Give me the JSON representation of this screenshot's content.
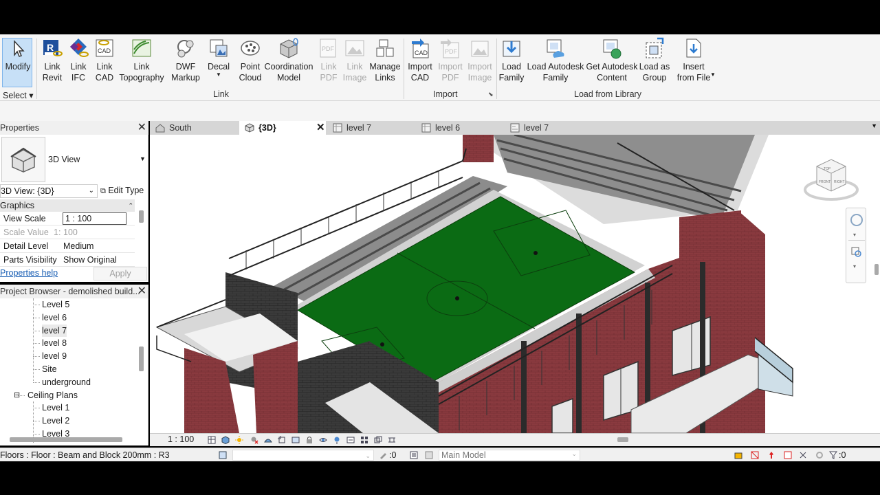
{
  "ribbon": {
    "buttons": [
      {
        "label": "Modify",
        "icon": "cursor-arrow-icon"
      },
      {
        "label": "Link\nRevit",
        "icon": "link-revit-icon"
      },
      {
        "label": "Link\nIFC",
        "icon": "link-ifc-icon"
      },
      {
        "label": "Link\nCAD",
        "icon": "link-cad-icon"
      },
      {
        "label": "Link\nTopography",
        "icon": "link-topography-icon"
      },
      {
        "label": "DWF\nMarkup",
        "icon": "dwf-markup-icon"
      },
      {
        "label": "Decal",
        "icon": "decal-icon"
      },
      {
        "label": "Point\nCloud",
        "icon": "point-cloud-icon"
      },
      {
        "label": "Coordination\nModel",
        "icon": "coordination-model-icon"
      },
      {
        "label": "Link\nPDF",
        "icon": "link-pdf-icon",
        "disabled": true
      },
      {
        "label": "Link\nImage",
        "icon": "link-image-icon",
        "disabled": true
      },
      {
        "label": "Manage\nLinks",
        "icon": "manage-links-icon"
      },
      {
        "label": "Import\nCAD",
        "icon": "import-cad-icon"
      },
      {
        "label": "Import\nPDF",
        "icon": "import-pdf-icon",
        "disabled": true
      },
      {
        "label": "Import\nImage",
        "icon": "import-image-icon",
        "disabled": true
      },
      {
        "label": "Load\nFamily",
        "icon": "load-family-icon"
      },
      {
        "label": "Load Autodesk\nFamily",
        "icon": "load-autodesk-family-icon"
      },
      {
        "label": "Get Autodesk\nContent",
        "icon": "get-autodesk-content-icon"
      },
      {
        "label": "Load as\nGroup",
        "icon": "load-as-group-icon"
      },
      {
        "label": "Insert\nfrom File",
        "icon": "insert-from-file-icon"
      }
    ],
    "panels": {
      "select": "Select",
      "link": "Link",
      "import": "Import",
      "load_from_library": "Load from Library"
    }
  },
  "tabs": [
    {
      "label": "South",
      "icon": "elevation-view-icon"
    },
    {
      "label": "{3D}",
      "icon": "3d-view-icon",
      "active": true
    },
    {
      "label": "level 7",
      "icon": "plan-view-icon"
    },
    {
      "label": "level 6",
      "icon": "plan-view-icon"
    },
    {
      "label": "level 7",
      "icon": "ceiling-plan-icon"
    }
  ],
  "properties": {
    "title": "Properties",
    "type_name": "3D View",
    "view_selector": "3D View: {3D}",
    "edit_type": "Edit Type",
    "group": "Graphics",
    "rows": [
      {
        "key": "View Scale",
        "value": "1 : 100"
      },
      {
        "key": "Scale Value",
        "prefix": "1:",
        "value": "100",
        "dim": true
      },
      {
        "key": "Detail Level",
        "value": "Medium"
      },
      {
        "key": "Parts Visibility",
        "value": "Show Original"
      }
    ],
    "help": "Properties help",
    "apply": "Apply"
  },
  "browser": {
    "title": "Project Browser - demolished build...",
    "items": [
      {
        "label": "Level 5",
        "level": 2
      },
      {
        "label": "level 6",
        "level": 2
      },
      {
        "label": "level 7",
        "level": 2,
        "selected": true
      },
      {
        "label": "level 8",
        "level": 2
      },
      {
        "label": "level 9",
        "level": 2
      },
      {
        "label": "Site",
        "level": 2
      },
      {
        "label": "underground",
        "level": 2
      },
      {
        "label": "Ceiling Plans",
        "level": 1,
        "expander": "⊟"
      },
      {
        "label": "Level 1",
        "level": 2
      },
      {
        "label": "Level 2",
        "level": 2
      },
      {
        "label": "Level 3",
        "level": 2
      }
    ]
  },
  "viewcube": {
    "front": "FRONT",
    "right": "RIGHT",
    "top": "TOP"
  },
  "view_control": {
    "scale": "1 : 100"
  },
  "status": {
    "text": "Floors : Floor : Beam and Block 200mm : R3",
    "selection_count": ":0",
    "model": "Main Model",
    "filter_count": ":0"
  }
}
